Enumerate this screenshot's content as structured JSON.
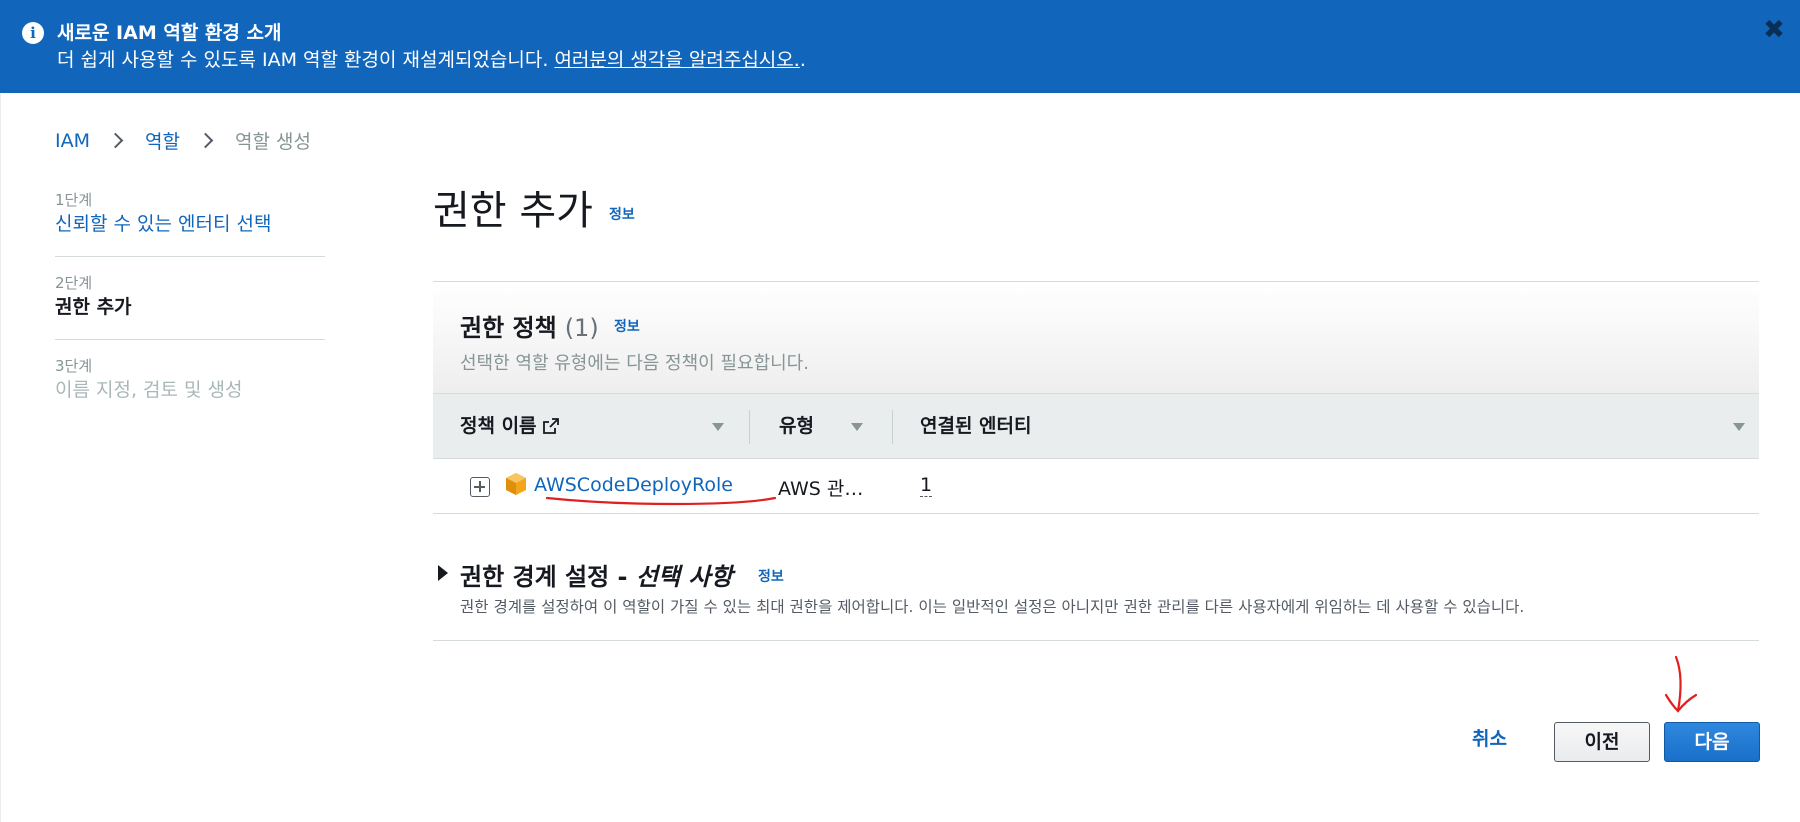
{
  "banner": {
    "title": "새로운 IAM 역할 환경 소개",
    "text": "더 쉽게 사용할 수 있도록 IAM 역할 환경이 재설계되었습니다. ",
    "link": "여러분의 생각을 알려주십시오.",
    "text_suffix": ".",
    "info_icon": "info-icon",
    "close_icon": "close-icon",
    "close_glyph": "✖",
    "color": "#1166bb"
  },
  "breadcrumb": {
    "items": [
      {
        "label": "IAM"
      },
      {
        "label": "역할"
      },
      {
        "label": "역할 생성"
      }
    ]
  },
  "steps": [
    {
      "num": "1단계",
      "label": "신뢰할 수 있는 엔터티 선택",
      "state": "done"
    },
    {
      "num": "2단계",
      "label": "권한 추가",
      "state": "active"
    },
    {
      "num": "3단계",
      "label": "이름 지정, 검토 및 생성",
      "state": "disabled"
    }
  ],
  "page": {
    "title": "권한 추가",
    "info": "정보"
  },
  "policies": {
    "title": "권한 정책",
    "count": "(1)",
    "info": "정보",
    "description": "선택한 역할 유형에는 다음 정책이 필요합니다.",
    "columns": [
      "정책 이름",
      "유형",
      "연결된 엔터티"
    ],
    "rows": [
      {
        "name": "AWSCodeDeployRole",
        "type": "AWS 관…",
        "entities": "1"
      }
    ]
  },
  "boundary": {
    "title": "권한 경계 설정 - ",
    "title_optional": "선택 사항",
    "info": "정보",
    "description": "권한 경계를 설정하여 이 역할이 가질 수 있는 최대 권한을 제어합니다. 이는 일반적인 설정은 아니지만 권한 관리를 다른 사용자에게 위임하는 데 사용할 수 있습니다."
  },
  "buttons": {
    "cancel": "취소",
    "previous": "이전",
    "next": "다음"
  },
  "colors": {
    "link": "#1166bb",
    "primary_button": "#1a6fc9",
    "annotation": "#e02020"
  }
}
